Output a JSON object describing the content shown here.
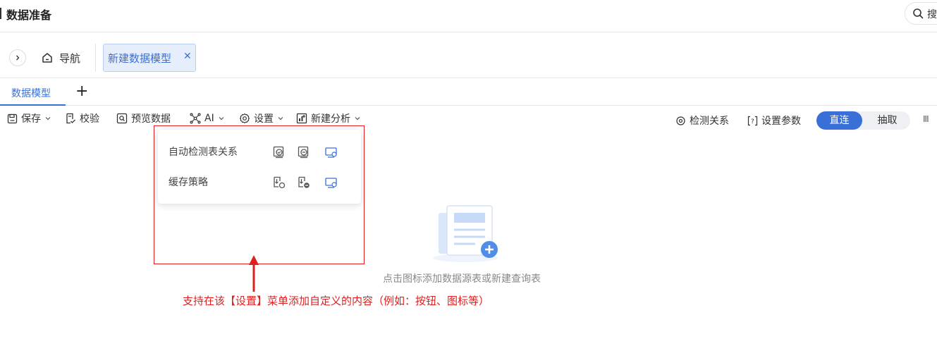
{
  "header": {
    "title": "数据准备",
    "search_text": "搜"
  },
  "tabs": {
    "nav_label": "导航",
    "open_tab_label": "新建数据模型",
    "close_glyph": "✕"
  },
  "model_tabs": {
    "active_label": "数据模型",
    "add_glyph": "+"
  },
  "toolbar": {
    "save_label": "保存",
    "validate_label": "校验",
    "preview_label": "预览数据",
    "ai_label": "AI",
    "settings_label": "设置",
    "new_analysis_label": "新建分析",
    "detect_relations_label": "检测关系",
    "set_params_label": "设置参数",
    "mode_direct": "直连",
    "mode_extract": "抽取",
    "columns_glyph": "III"
  },
  "settings_menu": {
    "rows": [
      {
        "label": "自动检测表关系"
      },
      {
        "label": "缓存策略"
      }
    ]
  },
  "empty_state": {
    "text": "点击图标添加数据源表或新建查询表"
  },
  "annotation": {
    "text": "支持在该【设置】菜单添加自定义的内容（例如：按钮、图标等）"
  },
  "colors": {
    "accent": "#3a6fd8",
    "annotation_red": "#e02020",
    "chip_bg": "#e6eefc"
  }
}
